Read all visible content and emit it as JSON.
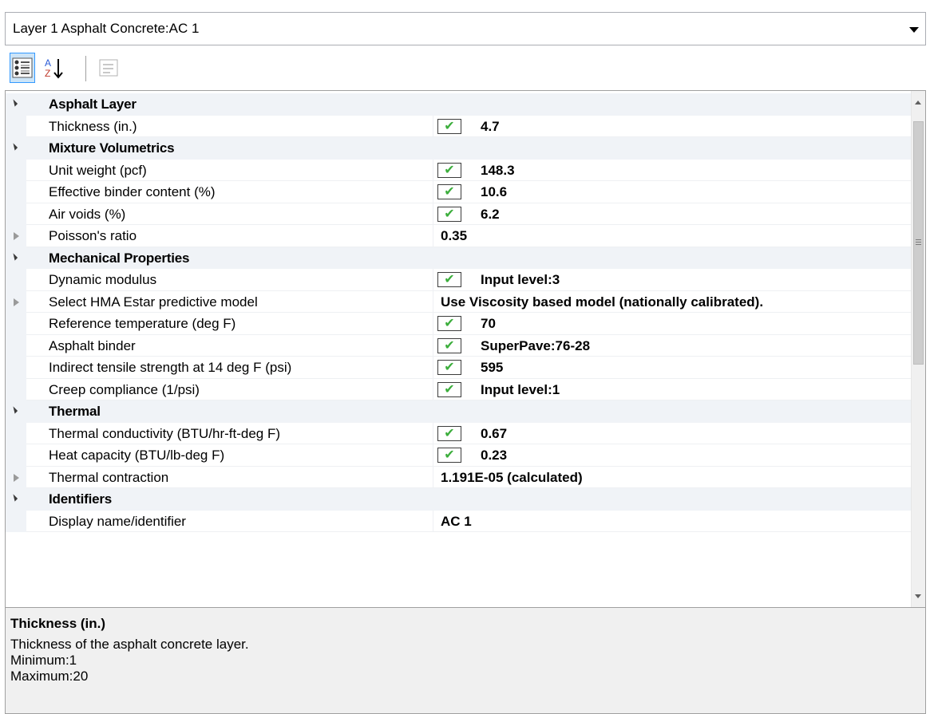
{
  "layer_select": {
    "value": "Layer 1 Asphalt Concrete:AC 1"
  },
  "toolbar": {
    "categorized_icon": "categorized-icon",
    "alphabetical_icon": "sort-alpha-icon",
    "property_pages_icon": "property-pages-icon"
  },
  "grid": {
    "rows": [
      {
        "type": "category",
        "label": "Asphalt Layer",
        "expanded": true
      },
      {
        "type": "property",
        "label": "Thickness (in.)",
        "checked": true,
        "value": "4.7"
      },
      {
        "type": "category",
        "label": "Mixture Volumetrics",
        "expanded": true
      },
      {
        "type": "property",
        "label": "Unit weight (pcf)",
        "checked": true,
        "value": "148.3"
      },
      {
        "type": "property",
        "label": "Effective binder content (%)",
        "checked": true,
        "value": "10.6"
      },
      {
        "type": "property",
        "label": "Air voids (%)",
        "checked": true,
        "value": "6.2"
      },
      {
        "type": "property",
        "label": "Poisson's ratio",
        "expandable": true,
        "value": "0.35"
      },
      {
        "type": "category",
        "label": "Mechanical Properties",
        "expanded": true
      },
      {
        "type": "property",
        "label": "Dynamic modulus",
        "checked": true,
        "value": "Input level:3"
      },
      {
        "type": "property",
        "label": "Select HMA Estar predictive model",
        "expandable": true,
        "value": "Use Viscosity based model (nationally calibrated)."
      },
      {
        "type": "property",
        "label": "Reference temperature (deg F)",
        "checked": true,
        "value": "70"
      },
      {
        "type": "property",
        "label": "Asphalt binder",
        "checked": true,
        "value": "SuperPave:76-28"
      },
      {
        "type": "property",
        "label": "Indirect tensile strength at 14 deg F (psi)",
        "checked": true,
        "value": "595"
      },
      {
        "type": "property",
        "label": "Creep compliance (1/psi)",
        "checked": true,
        "value": "Input level:1"
      },
      {
        "type": "category",
        "label": "Thermal",
        "expanded": true
      },
      {
        "type": "property",
        "label": "Thermal conductivity (BTU/hr-ft-deg F)",
        "checked": true,
        "value": "0.67"
      },
      {
        "type": "property",
        "label": "Heat capacity (BTU/lb-deg F)",
        "checked": true,
        "value": "0.23"
      },
      {
        "type": "property",
        "label": "Thermal contraction",
        "expandable": true,
        "value": "1.191E-05 (calculated)"
      },
      {
        "type": "category",
        "label": "Identifiers",
        "expanded": true
      },
      {
        "type": "property",
        "label": "Display name/identifier",
        "value": "AC 1"
      }
    ]
  },
  "help": {
    "title": "Thickness (in.)",
    "description": "Thickness of the asphalt concrete layer.",
    "minimum": "Minimum:1",
    "maximum": "Maximum:20"
  },
  "colors": {
    "category_bg": "#f0f3f7",
    "check_green": "#3cae3c",
    "selection_blue": "#cce4f7"
  }
}
